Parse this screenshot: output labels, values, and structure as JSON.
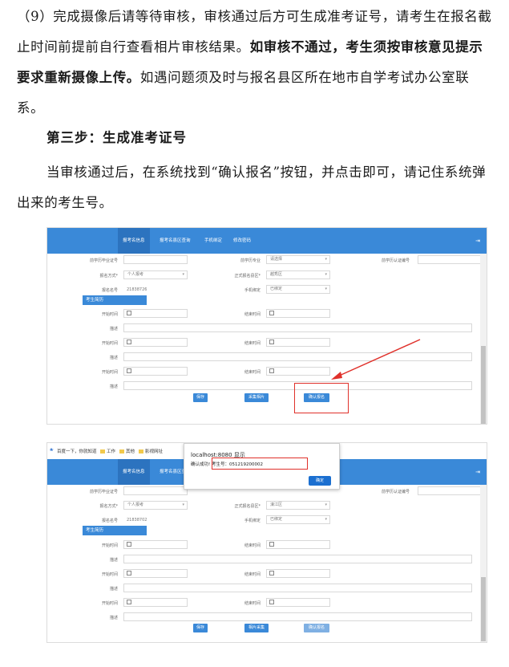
{
  "text": {
    "p1_normal": "（9）完成摄像后请等待审核，审核通过后方可生成准考证号，请考生在报名截止时间前提前自行查看相片审核结果。",
    "p1_bold": "如审核不通过，考生须按审核意见提示要求重新摄像上传。",
    "p1_tail": "如遇问题须及时与报名县区所在地市自学考试办公室联系。",
    "heading": "第三步：生成准考证号",
    "p2": "当审核通过后，在系统找到“确认报名”按钮，并点击即可，请记住系统弹出来的考生号。"
  },
  "shot1": {
    "nav": [
      "报考名信息",
      "报考名县区查询",
      "手机绑定",
      "修改密码"
    ],
    "fields": {
      "prior_cert_label": "前学历毕业证号",
      "prior_major_label": "前学历专业",
      "prior_major_value": "请选择",
      "prior_auth_label": "前学历认证编号",
      "method_label": "报名方式*",
      "method_value": "个人报考",
      "region_label": "正式报名县区*",
      "region_value": "越秀区",
      "reg_no_label": "报名名号",
      "reg_no_value": "21838726",
      "phone_label": "手机绑定",
      "phone_value": "已绑定"
    },
    "section": "考生简历",
    "start_label": "开始时间",
    "end_label": "结束时间",
    "desc_label": "描述",
    "buttons": [
      "保存",
      "采集相片",
      "确认报名"
    ]
  },
  "shot2": {
    "bookmarks": [
      "百度一下，你就知道",
      "工作",
      "其他",
      "影视网址"
    ],
    "dialog_title": "localhost:8080 显示",
    "dialog_msg_prefix": "确认成功!",
    "dialog_msg_exam": "考生号：051219200002",
    "dialog_ok": "确定",
    "nav": [
      "报考名信息",
      "报考名县区查"
    ],
    "fields": {
      "prior_cert_label": "前学历毕业证号",
      "prior_auth_label": "前学历认证编号",
      "method_label": "报名方式*",
      "method_value": "个人报考",
      "region_label": "正式报名县区*",
      "region_value": "濠江区",
      "reg_no_label": "报名名号",
      "reg_no_value": "21838702",
      "phone_label": "手机绑定",
      "phone_value": "已绑定"
    },
    "section": "考生简历",
    "start_label": "开始时间",
    "end_label": "结束时间",
    "desc_label": "描述",
    "buttons": [
      "保存",
      "相片采集",
      "确认报名"
    ]
  },
  "colors": {
    "topbar": "#3a89d8",
    "highlight": "#e0312b"
  }
}
